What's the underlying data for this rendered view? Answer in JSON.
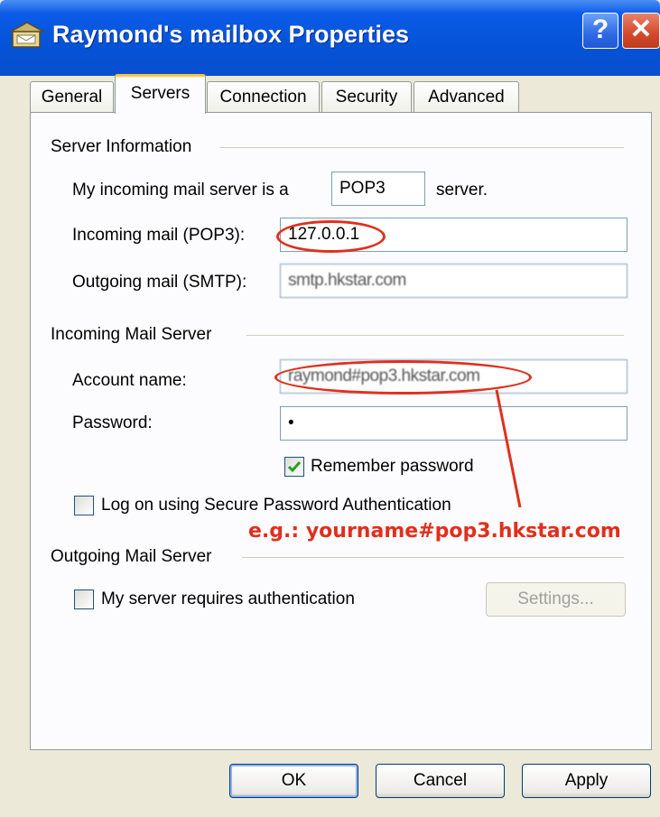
{
  "window": {
    "title": "Raymond's mailbox Properties",
    "help_label": "?",
    "close_label": "✕"
  },
  "tabs": [
    {
      "label": "General"
    },
    {
      "label": "Servers",
      "active": true
    },
    {
      "label": "Connection"
    },
    {
      "label": "Security"
    },
    {
      "label": "Advanced"
    }
  ],
  "server_info": {
    "heading": "Server Information",
    "incoming_type_prefix": "My incoming mail server is a",
    "incoming_type_value": "POP3",
    "incoming_type_suffix": "server.",
    "incoming_label": "Incoming mail (POP3):",
    "incoming_value": "127.0.0.1",
    "outgoing_label": "Outgoing mail (SMTP):",
    "outgoing_value": "smtp.hkstar.com"
  },
  "incoming_server": {
    "heading": "Incoming Mail Server",
    "account_label": "Account name:",
    "account_value": "raymond#pop3.hkstar.com",
    "password_label": "Password:",
    "password_value": "•",
    "remember_label": "Remember password",
    "remember_checked": true,
    "spa_label": "Log on using Secure Password Authentication",
    "spa_checked": false
  },
  "annotation": {
    "text": "e.g.: yourname#pop3.hkstar.com",
    "color": "#e0301c"
  },
  "outgoing_server": {
    "heading": "Outgoing Mail Server",
    "auth_label": "My server requires authentication",
    "auth_checked": false,
    "settings_label": "Settings..."
  },
  "buttons": {
    "ok": "OK",
    "cancel": "Cancel",
    "apply": "Apply"
  }
}
